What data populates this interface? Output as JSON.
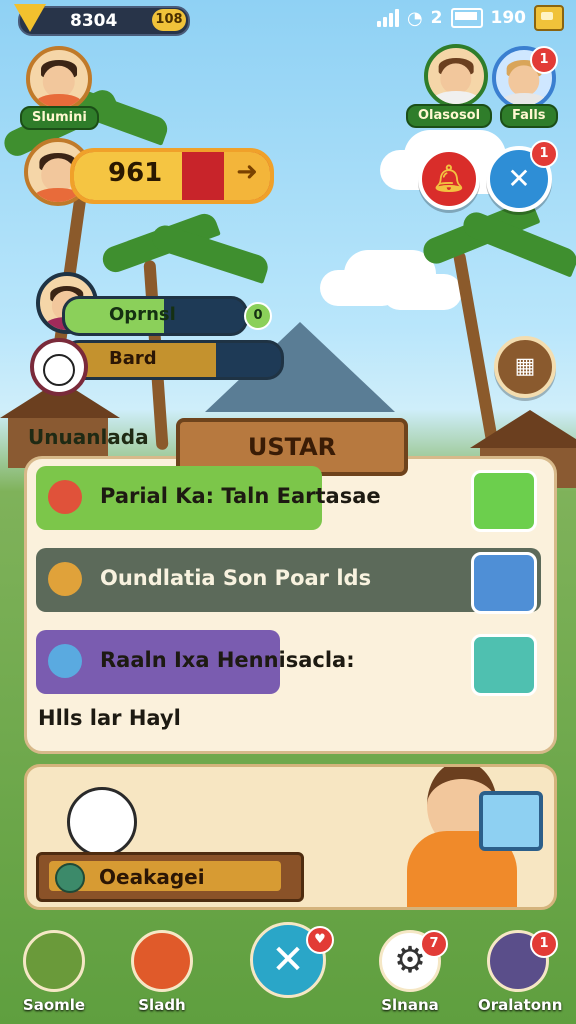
{
  "status_bar": {
    "gem_count": "8304",
    "gem_badge": "108",
    "battery_text": "2",
    "time": "190"
  },
  "friends": {
    "me": {
      "name": "Slumini"
    },
    "friend_1": {
      "name": "Olasosol"
    },
    "friend_2": {
      "name": "Falls",
      "badge": "1"
    }
  },
  "score": {
    "value": "961",
    "fill_fraction": 0.55
  },
  "action_buttons": {
    "tools_badge": "1"
  },
  "profile": {
    "progress_label": "Oprnsl",
    "progress_fill_fraction": 0.55,
    "progress_badge": "0",
    "bard_label": "Bard",
    "bard_fill_fraction": 0.7
  },
  "panel": {
    "side_label": "Unuanlada",
    "title": "USTAR",
    "tasks": [
      {
        "label": "Parial Ka: Taln Eartasae",
        "tag_color": "#7cc64a"
      },
      {
        "label": "Oundlatia Son Poar lds",
        "tag_color": "#5c6a5a"
      },
      {
        "label": "Raaln Ixa Hennisacla:",
        "tag_color": "#7a5cb0"
      }
    ],
    "footer_text": "Hlls lar Hayl"
  },
  "card": {
    "button_label": "Oeakagei"
  },
  "nav": [
    {
      "label": "Saomle"
    },
    {
      "label": "Sladh"
    },
    {
      "label": ""
    },
    {
      "label": "Slnana",
      "badge": "7"
    },
    {
      "label": "Oralatonn",
      "badge": "1"
    }
  ],
  "colors": {
    "sky": "#8fd1f4",
    "grass": "#5f9f3f",
    "accent_gold": "#f5c542",
    "red": "#c8242a"
  }
}
